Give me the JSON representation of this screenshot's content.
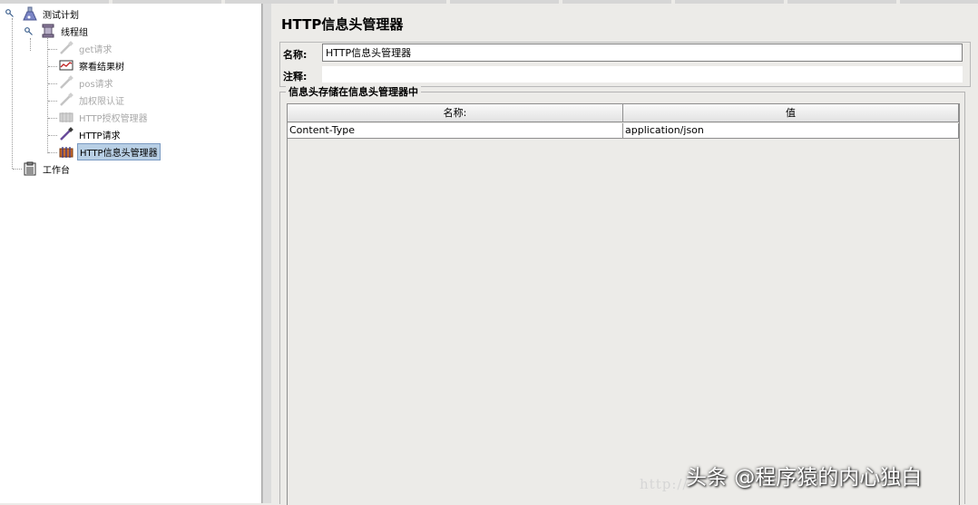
{
  "tree": {
    "items": [
      {
        "label": "测试计划",
        "icon": "flask-icon",
        "disabled": false,
        "selected": false
      },
      {
        "label": "线程组",
        "icon": "spool-icon",
        "disabled": false,
        "selected": false
      },
      {
        "label": "get请求",
        "icon": "pipette-icon",
        "disabled": true,
        "selected": false
      },
      {
        "label": "察看结果树",
        "icon": "graph-icon",
        "disabled": false,
        "selected": false
      },
      {
        "label": "pos请求",
        "icon": "pipette-icon",
        "disabled": true,
        "selected": false
      },
      {
        "label": "加权限认证",
        "icon": "pipette-icon",
        "disabled": true,
        "selected": false
      },
      {
        "label": "HTTP授权管理器",
        "icon": "config-icon",
        "disabled": true,
        "selected": false
      },
      {
        "label": "HTTP请求",
        "icon": "pipette-icon",
        "disabled": false,
        "selected": false
      },
      {
        "label": "HTTP信息头管理器",
        "icon": "header-manager-icon",
        "disabled": false,
        "selected": true
      },
      {
        "label": "工作台",
        "icon": "clipboard-icon",
        "disabled": false,
        "selected": false
      }
    ]
  },
  "panel": {
    "title": "HTTP信息头管理器",
    "name_label": "名称:",
    "name_value": "HTTP信息头管理器",
    "comment_label": "注释:",
    "comment_value": "",
    "group_title": "信息头存储在信息头管理器中",
    "table": {
      "columns": [
        "名称:",
        "值"
      ],
      "rows": [
        {
          "name": "Content-Type",
          "value": "application/json"
        }
      ]
    }
  },
  "watermark": {
    "text": "头条 @程序猿的内心独白",
    "url": "http://"
  },
  "colors": {
    "selection": "#b8cfe5",
    "panel_bg": "#ecebe8"
  }
}
